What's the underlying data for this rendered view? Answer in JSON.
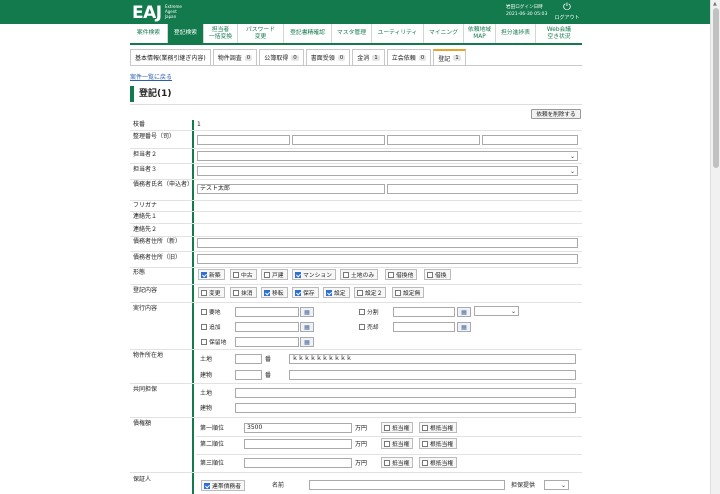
{
  "header": {
    "logo": "EAJ",
    "logo_sub": [
      "Extreme",
      "Agent",
      "Japan"
    ],
    "user_line1": "岩田ログイン日時",
    "user_line2": "2021-06-30 05:03",
    "logout": "ログアウト"
  },
  "nav": [
    {
      "label": "案件検索"
    },
    {
      "label": "登記検索"
    },
    {
      "label": "担当者\n一括変換"
    },
    {
      "label": "パスワード\n変更"
    },
    {
      "label": "登記書精確認"
    },
    {
      "label": "マスタ管理"
    },
    {
      "label": "ユーティリティ"
    },
    {
      "label": "マイニング"
    },
    {
      "label": "依頼地域\nMAP"
    },
    {
      "label": "担分進捗表"
    },
    {
      "label": "Web会議\n空き状況"
    }
  ],
  "tabs": [
    {
      "label": "基本情報(業務引継ぎ内容)",
      "count": ""
    },
    {
      "label": "物件調査",
      "count": "0"
    },
    {
      "label": "公簿取得",
      "count": "0"
    },
    {
      "label": "書面受領",
      "count": "0"
    },
    {
      "label": "金消",
      "count": "1"
    },
    {
      "label": "立会依頼",
      "count": "0"
    },
    {
      "label": "登記",
      "count": "1"
    }
  ],
  "back_link": "案件一覧に戻る",
  "section_title": "登記(1)",
  "delete_button": "依頼を削除する",
  "labels": {
    "edaban": "枝番",
    "seiri": "整理番号（司）",
    "tanto2": "担当者２",
    "tanto3": "担当者３",
    "saimusha": "債務者氏名（申込者）",
    "furigana": "フリガナ",
    "renraku1": "連絡先１",
    "renraku2": "連絡先２",
    "jusho_new": "債務者住所（新）",
    "jusho_old": "債務者住所（旧）",
    "keitai": "形態",
    "touki_naiyou": "登記内容",
    "jikkou": "実行内容",
    "bukken": "物件所在地",
    "kyoudou": "共同担保",
    "saiken": "債権額",
    "hoshounin": "保証人"
  },
  "values": {
    "edaban": "1",
    "saimusha_name": "テスト太郎",
    "tochi_chiban": "ｋｋｋｋｋｋｋｋｋｋ",
    "saiken1": "3500"
  },
  "keitai_options": [
    {
      "label": "新築",
      "checked": true
    },
    {
      "label": "中古",
      "checked": false
    },
    {
      "label": "戸建",
      "checked": false
    },
    {
      "label": "マンション",
      "checked": true
    },
    {
      "label": "土地のみ",
      "checked": false
    },
    {
      "label": "借換他",
      "checked": false
    },
    {
      "label": "借換",
      "checked": false
    }
  ],
  "touki_options": [
    {
      "label": "変更",
      "checked": false
    },
    {
      "label": "抹消",
      "checked": false
    },
    {
      "label": "移転",
      "checked": true
    },
    {
      "label": "保存",
      "checked": true
    },
    {
      "label": "設定",
      "checked": true
    },
    {
      "label": "設定２",
      "checked": false
    },
    {
      "label": "設定無",
      "checked": false
    }
  ],
  "jikkou_items": {
    "youchi": "要地",
    "tsuika": "追加",
    "hokanchi": "保留地",
    "bunkatsu": "分割",
    "baikyaku": "売却"
  },
  "bukken_fields": {
    "tochi": "土地",
    "tatemono": "建物",
    "ban": "番"
  },
  "saiken_rows": {
    "rank1": "第一順位",
    "rank2": "第二順位",
    "rank3": "第三順位",
    "unit": "万円",
    "teitou": "抵当権",
    "ne_teitou": "根抵当権"
  },
  "hoshounin_fields": {
    "rentai": "連帯債務者",
    "name": "名前",
    "tanpo": "担保提供"
  }
}
